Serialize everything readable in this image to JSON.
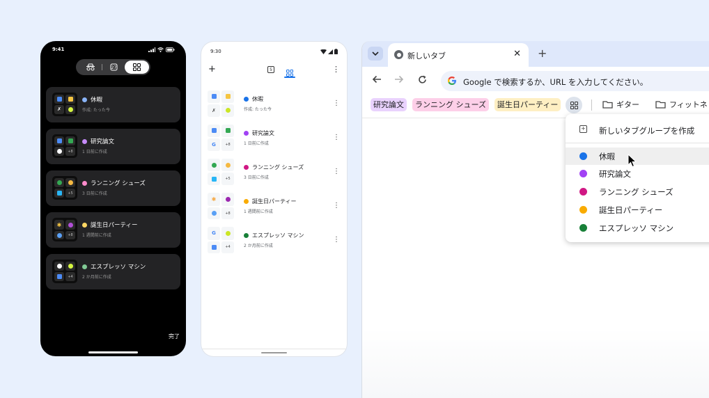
{
  "ios": {
    "time": "9:41",
    "done_label": "完了",
    "groups": [
      {
        "title": "休暇",
        "subtitle": "作成: たった今",
        "color": "#8ab4f8",
        "extra": ""
      },
      {
        "title": "研究論文",
        "subtitle": "1 日前に作成",
        "color": "#c58af9",
        "extra": "+8"
      },
      {
        "title": "ランニング シューズ",
        "subtitle": "3 日前に作成",
        "color": "#ff8bcb",
        "extra": "+5"
      },
      {
        "title": "誕生日パーティー",
        "subtitle": "1 週間前に作成",
        "color": "#fdd663",
        "extra": "+8"
      },
      {
        "title": "エスプレッソ マシン",
        "subtitle": "2 か月前に作成",
        "color": "#81c995",
        "extra": "+4"
      }
    ]
  },
  "android": {
    "time": "9:30",
    "groups": [
      {
        "title": "休暇",
        "subtitle": "作成: たった今",
        "color": "#1a73e8",
        "extra": ""
      },
      {
        "title": "研究論文",
        "subtitle": "1 日前に作成",
        "color": "#a142f4",
        "extra": "+8"
      },
      {
        "title": "ランニング シューズ",
        "subtitle": "3 日前に作成",
        "color": "#d01884",
        "extra": "+5"
      },
      {
        "title": "誕生日パーティー",
        "subtitle": "1 週間前に作成",
        "color": "#f9ab00",
        "extra": "+8"
      },
      {
        "title": "エスプレッソ マシン",
        "subtitle": "2 か月前に作成",
        "color": "#188038",
        "extra": "+4"
      }
    ]
  },
  "chrome": {
    "tab_title": "新しいタブ",
    "omnibox_placeholder": "Google で検索するか、URL を入力してください。",
    "bookmark_chips": [
      {
        "label": "研究論文",
        "bg": "#e9d2fd"
      },
      {
        "label": "ランニング シューズ",
        "bg": "#fdcfe8"
      },
      {
        "label": "誕生日パーティー",
        "bg": "#feefc3"
      }
    ],
    "folders": [
      "ギター",
      "フィットネ"
    ],
    "menu": {
      "create_label": "新しいタブグループを作成",
      "items": [
        {
          "label": "休暇",
          "color": "#1a73e8"
        },
        {
          "label": "研究論文",
          "color": "#a142f4"
        },
        {
          "label": "ランニング シューズ",
          "color": "#d01884"
        },
        {
          "label": "誕生日パーティー",
          "color": "#f9ab00"
        },
        {
          "label": "エスプレッソ マシン",
          "color": "#188038"
        }
      ]
    }
  }
}
